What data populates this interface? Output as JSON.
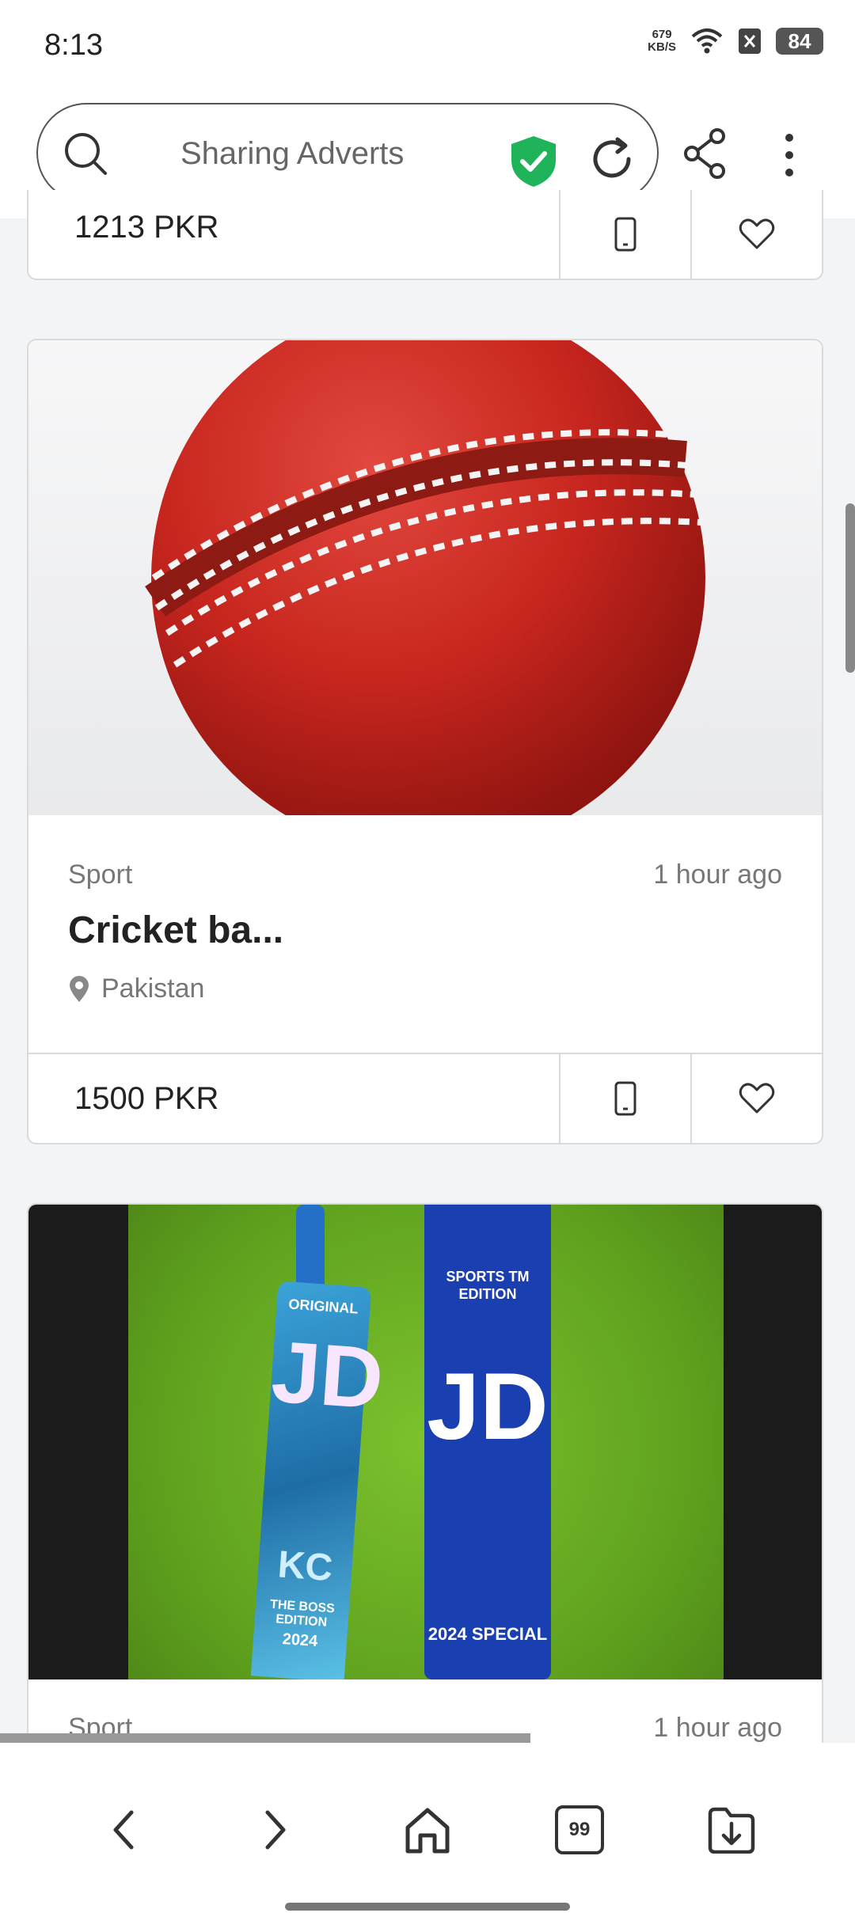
{
  "status_bar": {
    "time": "8:13",
    "net_speed_value": "679",
    "net_speed_unit": "KB/S",
    "battery": "84"
  },
  "toolbar": {
    "search_text": "Sharing Adverts",
    "shield_color": "#1fb45a"
  },
  "cards": [
    {
      "price": "1213 PKR"
    },
    {
      "category": "Sport",
      "time": "1 hour ago",
      "title": "Cricket ba...",
      "location": "Pakistan",
      "price": "1500 PKR",
      "image": "red-cricket-ball"
    },
    {
      "category": "Sport",
      "time": "1 hour ago",
      "image": "cricket-bats-on-grass",
      "image_text": {
        "bat1_top": "ORIGINAL",
        "bat1_logo": "JD",
        "bat1_sub": "KC",
        "bat1_edition": "THE BOSS EDITION",
        "bat1_year": "2024",
        "bat2_top": "SPORTS TM EDITION",
        "bat2_logo": "JD",
        "bat2_bottom": "2024 SPECIAL"
      }
    }
  ],
  "bottom_nav": {
    "tabs_count": "99"
  }
}
